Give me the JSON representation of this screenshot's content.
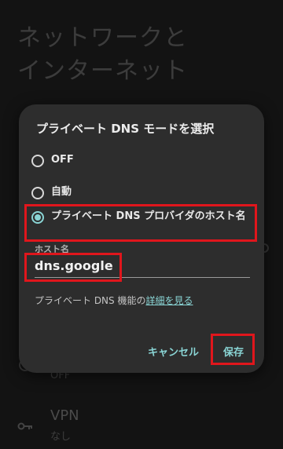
{
  "background": {
    "title": "ネットワークと\nインターネット",
    "items": [
      {
        "label": "",
        "sub": "OFF"
      },
      {
        "label": "VPN",
        "sub": "なし"
      }
    ]
  },
  "dialog": {
    "title": "プライベート DNS モードを選択",
    "options": [
      {
        "label": "OFF",
        "checked": false
      },
      {
        "label": "自動",
        "checked": false
      },
      {
        "label": "プライベート DNS プロバイダのホスト名",
        "checked": true
      }
    ],
    "host_label": "ホスト名",
    "host_value": "dns.google",
    "info_text": "プライベート DNS 機能の",
    "info_link": "詳細を見る",
    "cancel_label": "キャンセル",
    "save_label": "保存"
  },
  "colors": {
    "accent": "#8ad5d5",
    "highlight": "#e0161c",
    "dialog_bg": "#2d2d2d"
  }
}
